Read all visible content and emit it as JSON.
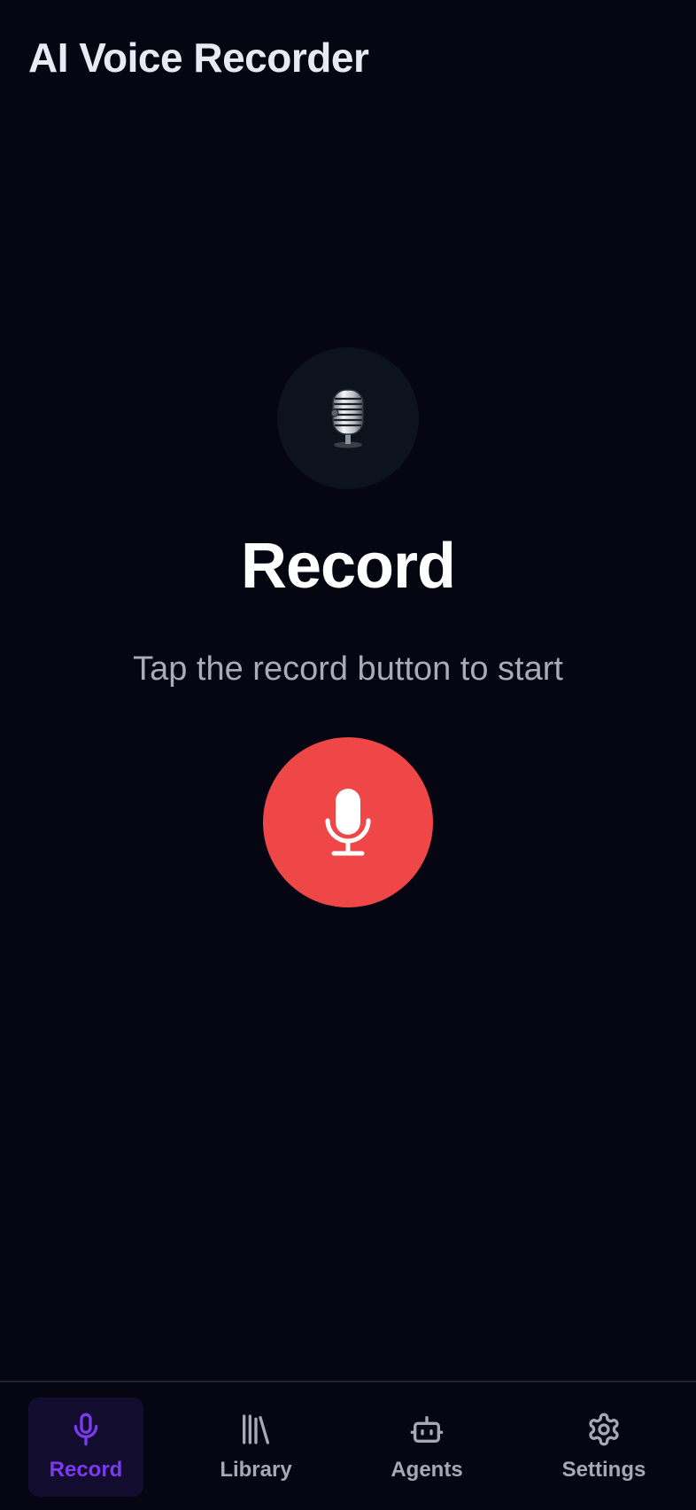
{
  "header": {
    "title": "AI Voice Recorder"
  },
  "main": {
    "hero_icon": "studio-microphone-icon",
    "heading": "Record",
    "hint": "Tap the record button to start",
    "record_button_icon": "microphone-icon"
  },
  "bottom_nav": {
    "items": [
      {
        "label": "Record",
        "icon": "microphone-icon",
        "active": true
      },
      {
        "label": "Library",
        "icon": "library-icon",
        "active": false
      },
      {
        "label": "Agents",
        "icon": "bot-icon",
        "active": false
      },
      {
        "label": "Settings",
        "icon": "gear-icon",
        "active": false
      }
    ]
  },
  "colors": {
    "background": "#050612",
    "record_red": "#ef4648",
    "accent_purple": "#7c3aed",
    "active_tab_bg": "#120c2e",
    "muted_text": "#a8abb8"
  }
}
